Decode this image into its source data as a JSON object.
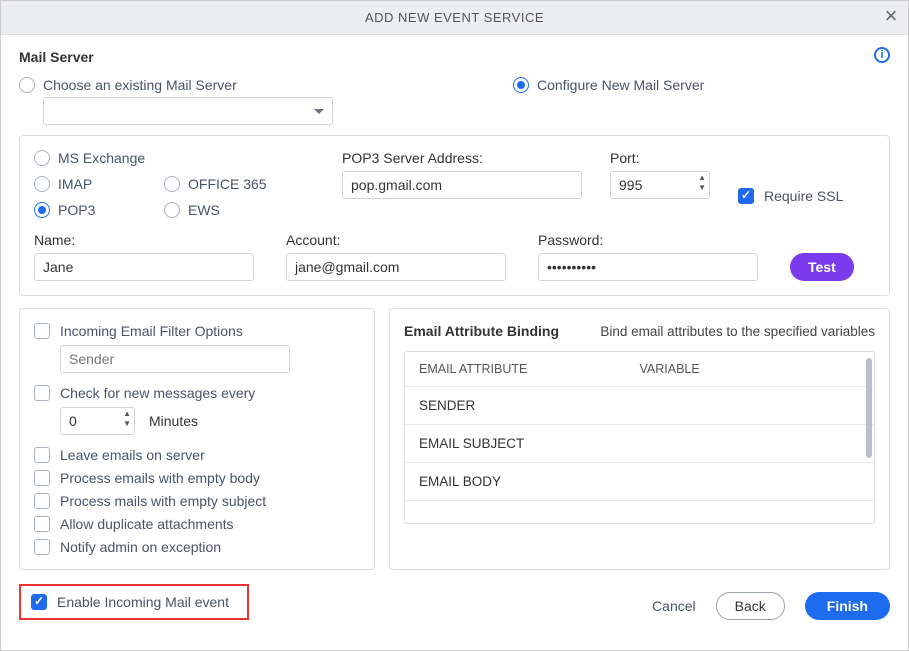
{
  "header": {
    "title": "ADD NEW EVENT SERVICE"
  },
  "mailServer": {
    "label": "Mail Server",
    "chooseExisting": "Choose an existing Mail Server",
    "configureNew": "Configure New Mail Server"
  },
  "protocols": {
    "msExchange": "MS Exchange",
    "imap": "IMAP",
    "office365": "OFFICE 365",
    "pop3": "POP3",
    "ews": "EWS"
  },
  "server": {
    "addressLabel": "POP3 Server Address:",
    "addressValue": "pop.gmail.com",
    "portLabel": "Port:",
    "portValue": "995",
    "requireSsl": "Require SSL",
    "nameLabel": "Name:",
    "nameValue": "Jane",
    "accountLabel": "Account:",
    "accountValue": "jane@gmail.com",
    "passwordLabel": "Password:",
    "passwordValue": "••••••••••",
    "testLabel": "Test"
  },
  "filter": {
    "optionsLabel": "Incoming Email Filter Options",
    "senderPlaceholder": "Sender",
    "checkEveryLabel": "Check for new messages every",
    "minutesValue": "0",
    "minutesLabel": "Minutes",
    "leaveEmails": "Leave emails on server",
    "processEmptyBody": "Process emails with empty body",
    "processEmptySubject": "Process mails with empty subject",
    "allowDuplicate": "Allow duplicate attachments",
    "notifyAdmin": "Notify admin on exception",
    "enableEvent": "Enable Incoming Mail event"
  },
  "binding": {
    "title": "Email Attribute Binding",
    "subtitle": "Bind email attributes to the specified variables",
    "colAttr": "EMAIL ATTRIBUTE",
    "colVar": "VARIABLE",
    "rows": [
      "SENDER",
      "EMAIL SUBJECT",
      "EMAIL BODY"
    ]
  },
  "footer": {
    "cancel": "Cancel",
    "back": "Back",
    "finish": "Finish"
  }
}
